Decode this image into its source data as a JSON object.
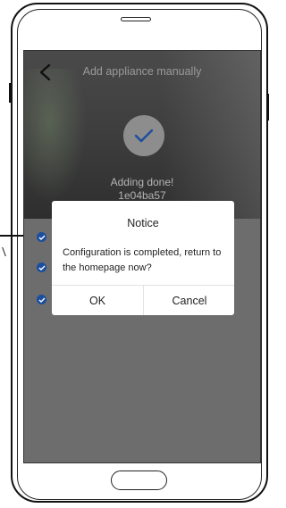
{
  "header": {
    "title": "Add appliance manually"
  },
  "status": {
    "message": "Adding done!",
    "device_id": "1e04ba57"
  },
  "dialog": {
    "title": "Notice",
    "message": "Configuration is completed, return to the homepage now?",
    "ok_label": "OK",
    "cancel_label": "Cancel"
  },
  "icons": {
    "back": "chevron-left-icon",
    "success": "checkmark-icon",
    "list": "check-dot-icon"
  },
  "colors": {
    "accent": "#1c4e9e",
    "overlay": "#6d6d6d",
    "dialog_bg": "#ffffff"
  }
}
